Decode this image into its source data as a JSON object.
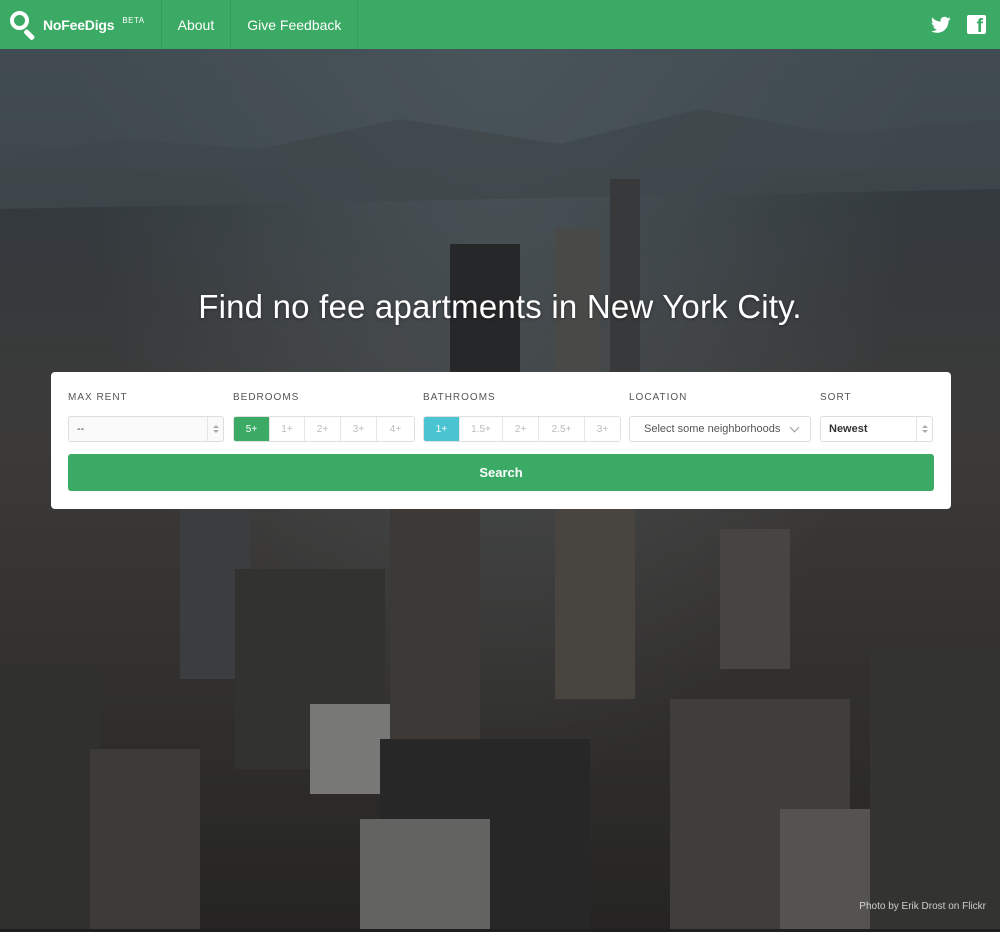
{
  "brand": {
    "name": "NoFeeDigs",
    "badge": "BETA"
  },
  "nav": {
    "items": [
      {
        "label": "About"
      },
      {
        "label": "Give Feedback"
      }
    ],
    "social": [
      "twitter-icon",
      "facebook-icon"
    ]
  },
  "hero": {
    "headline": "Find no fee apartments in New York City."
  },
  "search": {
    "max_rent": {
      "label": "MAX RENT",
      "value": "--"
    },
    "bedrooms": {
      "label": "BEDROOMS",
      "options": [
        "5+",
        "1+",
        "2+",
        "3+",
        "4+"
      ],
      "selected": "5+"
    },
    "bathrooms": {
      "label": "BATHROOMS",
      "options": [
        "1+",
        "1.5+",
        "2+",
        "2.5+",
        "3+"
      ],
      "selected": "1+"
    },
    "location": {
      "label": "LOCATION",
      "placeholder": "Select some neighborhoods"
    },
    "sort": {
      "label": "SORT",
      "value": "Newest"
    },
    "button_label": "Search"
  },
  "photo_credit": "Photo by Erik Drost on Flickr",
  "colors": {
    "brand_green": "#3aaa64",
    "bath_active": "#4bc4d1"
  }
}
